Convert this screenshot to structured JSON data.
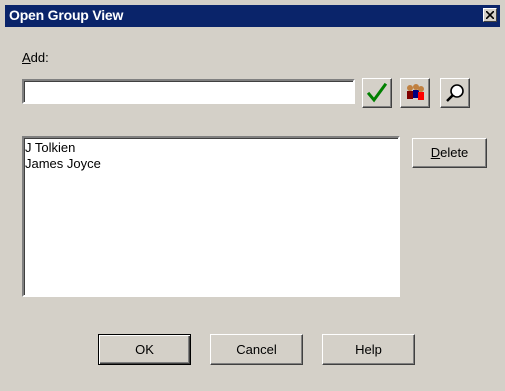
{
  "window": {
    "title": "Open Group View",
    "close_icon": "close-icon"
  },
  "add": {
    "label_accel": "A",
    "label_rest": "dd:",
    "value": "",
    "placeholder": ""
  },
  "toolbar": {
    "icons": [
      "checkmark-icon",
      "people-icon",
      "magnifier-icon"
    ],
    "check_color": "#008000"
  },
  "list": {
    "items": [
      "J Tolkien",
      "James Joyce"
    ]
  },
  "buttons": {
    "delete_accel": "D",
    "delete_rest": "elete",
    "ok": "OK",
    "cancel": "Cancel",
    "help": "Help"
  },
  "colors": {
    "titlebar": "#0a246a",
    "dialog_bg": "#d4d0c8"
  }
}
